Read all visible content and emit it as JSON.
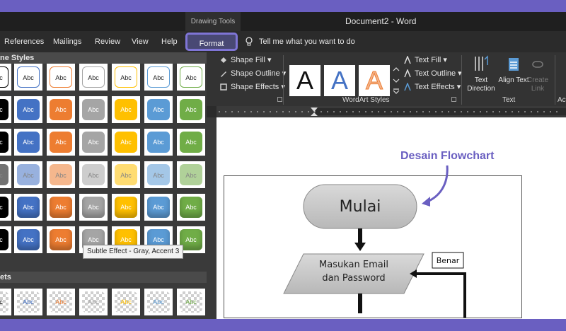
{
  "titlebar": {
    "contextual_label": "Drawing Tools",
    "document_title": "Document2  -  Word"
  },
  "tabs": [
    {
      "label": "References"
    },
    {
      "label": "Mailings"
    },
    {
      "label": "Review"
    },
    {
      "label": "View"
    },
    {
      "label": "Help"
    },
    {
      "label": "Format"
    }
  ],
  "tell_me": "Tell me what you want to do",
  "gallery": {
    "section1_title": "ne Styles",
    "section2_title": "ets",
    "swatch_text": "Abc",
    "tooltip": "Subtle Effect - Gray, Accent 3",
    "theme_colors": [
      "#000000",
      "#4472c4",
      "#ed7d31",
      "#a5a5a5",
      "#ffc000",
      "#5b9bd5",
      "#70ad47"
    ]
  },
  "ribbon": {
    "shape_fill": "Shape Fill",
    "shape_outline": "Shape Outline",
    "shape_effects": "Shape Effects",
    "wordart_letter": "A",
    "text_fill": "Text Fill",
    "text_outline": "Text Outline",
    "text_effects": "Text Effects",
    "wordart_group": "WordArt Styles",
    "text_direction": "Text Direction",
    "align_text": "Align Text",
    "create_link": "Create Link",
    "text_group": "Text",
    "acc_group": "Acc"
  },
  "document": {
    "annotation": "Desain Flowchart",
    "shapes": {
      "start": "Mulai",
      "input_line1": "Masukan Email",
      "input_line2": "dan Password",
      "true_label": "Benar"
    }
  }
}
